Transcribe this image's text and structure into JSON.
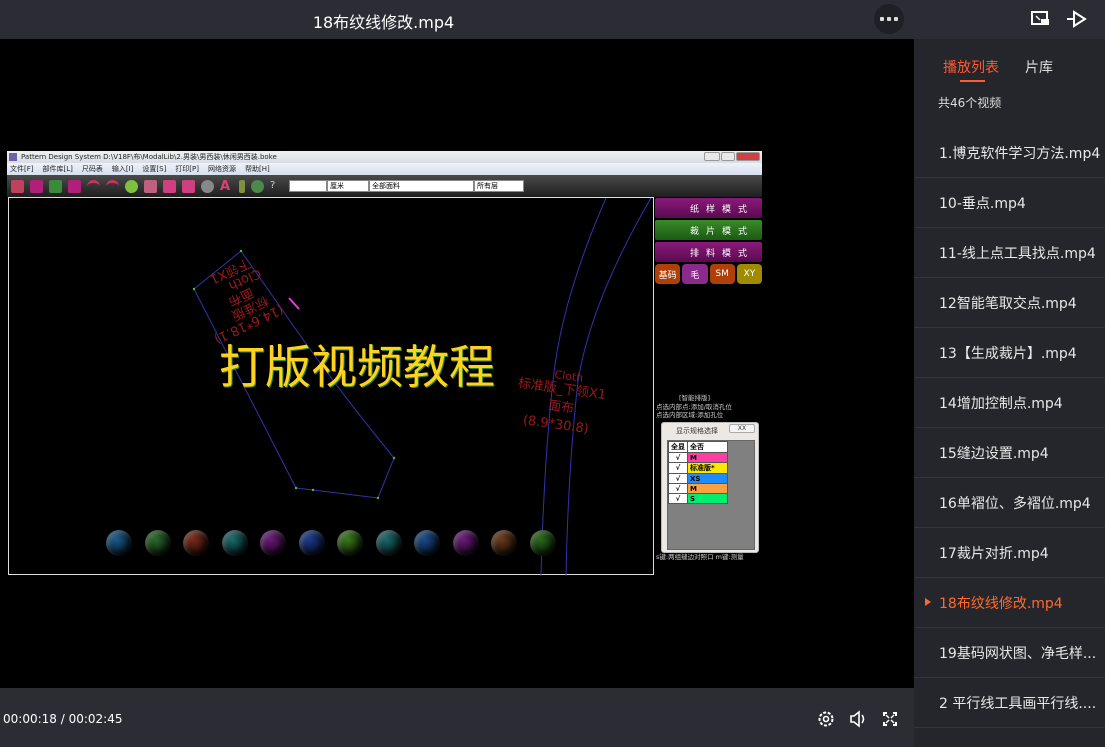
{
  "header": {
    "title": "18布纹线修改.mp4",
    "more_icon": "more-icon",
    "pip_icon": "picture-in-picture-icon",
    "cast_icon": "cast-icon"
  },
  "player": {
    "overlay_caption": "打版视频教程",
    "current_time": "00:00:18",
    "separator": " / ",
    "duration": "00:02:45",
    "controls": [
      "settings-icon",
      "volume-icon",
      "fullscreen-icon"
    ]
  },
  "app": {
    "title": "Pattern Design System   D:\\V18F\\布\\ModalLib\\2.男装\\男西装\\休闲男西装.boke",
    "menu": [
      "文件[F]",
      "部件库[L]",
      "尺码表",
      "输入[I]",
      "设置[S]",
      "打印[P]",
      "网络资源",
      "帮助[H]"
    ],
    "unit_select": "厘米",
    "fabric_select": "全部面料",
    "layer_select": "所有层",
    "modes": [
      "纸样模式",
      "裁片模式",
      "排料模式"
    ],
    "small_buttons": [
      "基码",
      "毛",
      "SM",
      "XY"
    ],
    "panel_heading": "[智能排版]",
    "panel_lines": [
      "点选内部点:添加/取消孔位",
      "点选内部区域:添加孔位"
    ],
    "panel_footer": "s键:两组缝边对照口   m键:测量",
    "piece1_labels": [
      "标准版",
      "面布",
      "(14.6*18.1)",
      "Cloth",
      "下领X1"
    ],
    "piece2_labels": [
      "Cloth",
      "标准版_下领X1",
      "面布",
      "(8.9*30.8)"
    ],
    "size_dialog": {
      "title": "显示规格选择",
      "close": "XX",
      "headers": [
        "全显",
        "全否"
      ],
      "rows": [
        {
          "check": "√",
          "size": "M",
          "color": "#ff3fa0"
        },
        {
          "check": "√",
          "size": "标准版*",
          "color": "#ffe600"
        },
        {
          "check": "√",
          "size": "XS",
          "color": "#1e8cff"
        },
        {
          "check": "√",
          "size": "M",
          "color": "#ffa040"
        },
        {
          "check": "√",
          "size": "S",
          "color": "#00ee70"
        }
      ]
    }
  },
  "sidebar": {
    "tabs": [
      {
        "label": "播放列表",
        "active": true
      },
      {
        "label": "片库",
        "active": false
      }
    ],
    "count": "共46个视频",
    "items": [
      {
        "label": "1.博克软件学习方法.mp4"
      },
      {
        "label": "10-垂点.mp4"
      },
      {
        "label": "11-线上点工具找点.mp4"
      },
      {
        "label": "12智能笔取交点.mp4"
      },
      {
        "label": "13【生成裁片】.mp4"
      },
      {
        "label": "14增加控制点.mp4"
      },
      {
        "label": "15缝边设置.mp4"
      },
      {
        "label": "16单褶位、多褶位.mp4"
      },
      {
        "label": "17裁片对折.mp4"
      },
      {
        "label": "18布纹线修改.mp4",
        "current": true
      },
      {
        "label": "19基码网状图、净毛样..."
      },
      {
        "label": "2 平行线工具画平行线...."
      }
    ],
    "accent": "#ff5a32"
  }
}
